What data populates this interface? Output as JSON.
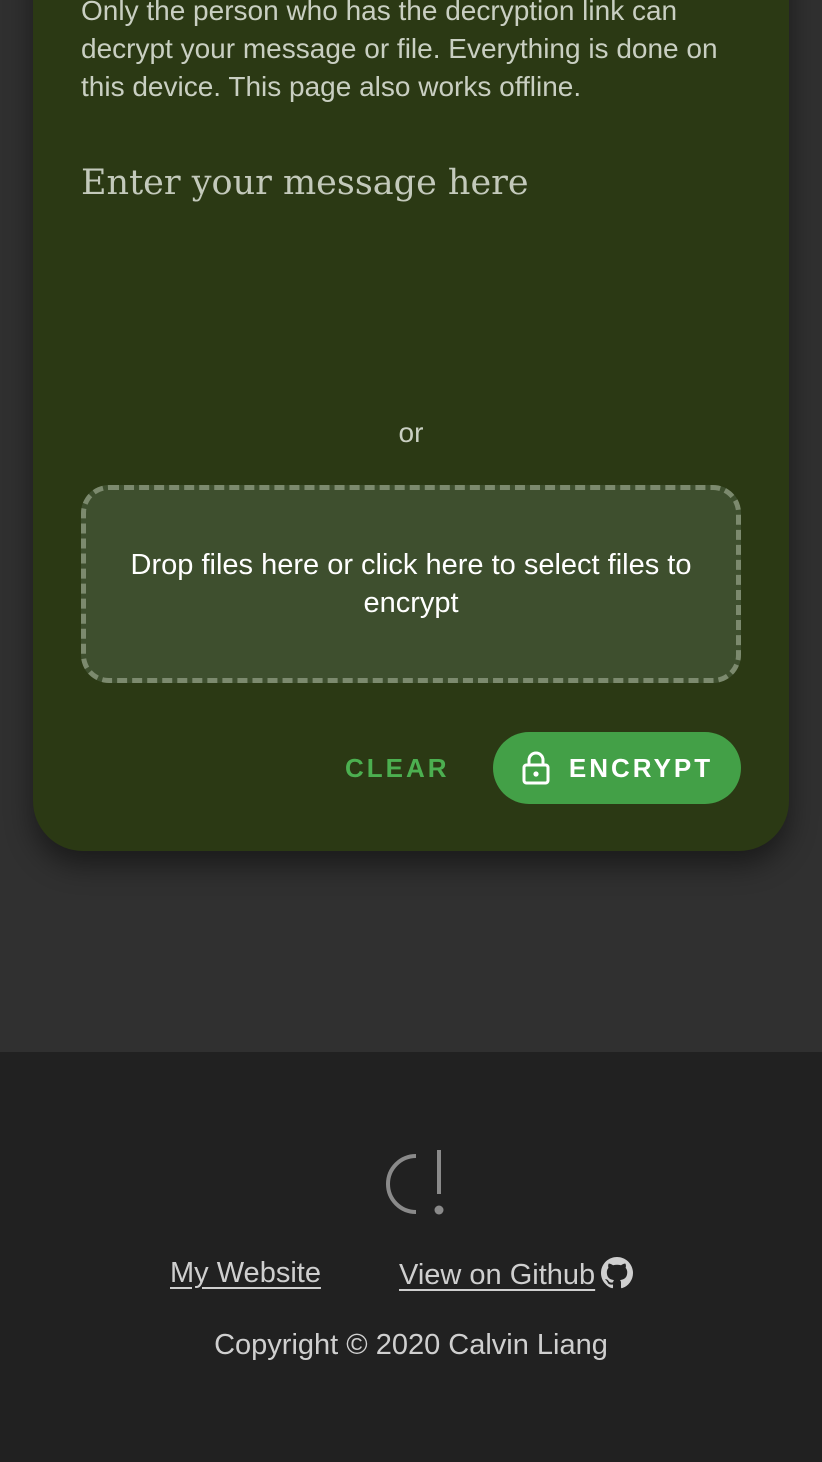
{
  "card": {
    "intro_text": "Only the person who has the decryption link can decrypt your message or file. Everything is done on this device. This page also works offline.",
    "message_placeholder": "Enter your message here",
    "or_label": "or",
    "dropzone_text": "Drop files here or click here to select files to encrypt",
    "clear_label": "CLEAR",
    "encrypt_label": "ENCRYPT",
    "encrypt_icon": "lock-icon"
  },
  "footer": {
    "logo_icon": "calvin-logo-icon",
    "links": {
      "website": "My Website",
      "github": "View on Github",
      "github_icon": "github-icon"
    },
    "copyright": "Copyright © 2020 Calvin Liang"
  },
  "colors": {
    "card_bg": "#2b3914",
    "accent": "#43a047",
    "footer_bg": "#212121",
    "page_bg": "#303030"
  }
}
